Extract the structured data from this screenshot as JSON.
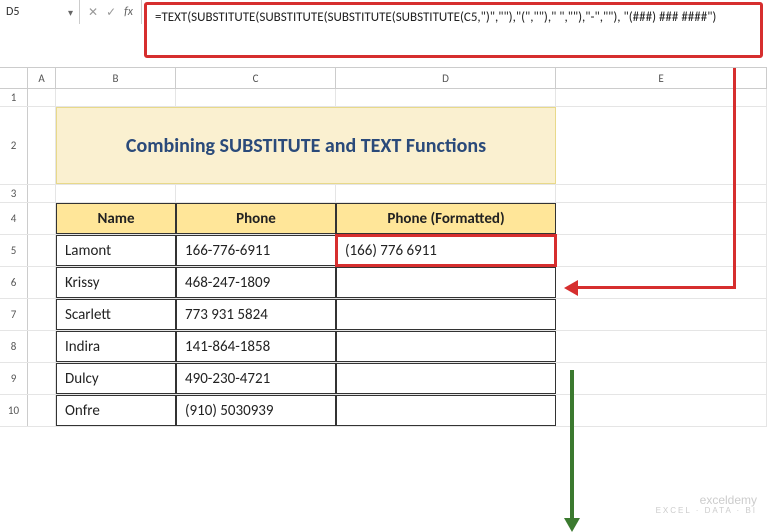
{
  "name_box": "D5",
  "formula": "=TEXT(SUBSTITUTE(SUBSTITUTE(SUBSTITUTE(SUBSTITUTE(C5,\")\",\"\"),\"(\",\"\"),\" \",\"\"),\"-\",\"\"), \"(###) ### ####\")",
  "cols": {
    "A": "A",
    "B": "B",
    "C": "C",
    "D": "D",
    "E": "E"
  },
  "rownums": {
    "1": "1",
    "2": "2",
    "3": "3",
    "4": "4",
    "5": "5",
    "6": "6",
    "7": "7",
    "8": "8",
    "9": "9",
    "10": "10"
  },
  "title": "Combining SUBSTITUTE and TEXT Functions",
  "headers": {
    "name": "Name",
    "phone": "Phone",
    "formatted": "Phone (Formatted)"
  },
  "rows": [
    {
      "name": "Lamont",
      "phone": "166-776-6911",
      "formatted": "(166) 776 6911"
    },
    {
      "name": "Krissy",
      "phone": "468-247-1809",
      "formatted": ""
    },
    {
      "name": "Scarlett",
      "phone": "773 931 5824",
      "formatted": ""
    },
    {
      "name": "Indira",
      "phone": "141-864-1858",
      "formatted": ""
    },
    {
      "name": "Dulcy",
      "phone": "490-230-4721",
      "formatted": ""
    },
    {
      "name": "Onfre",
      "phone": "(910) 5030939",
      "formatted": ""
    }
  ],
  "watermark": {
    "brand": "exceldemy",
    "sub": "EXCEL · DATA · BI"
  },
  "chart_data": {
    "type": "table",
    "title": "Combining SUBSTITUTE and TEXT Functions",
    "columns": [
      "Name",
      "Phone",
      "Phone (Formatted)"
    ],
    "rows": [
      [
        "Lamont",
        "166-776-6911",
        "(166) 776 6911"
      ],
      [
        "Krissy",
        "468-247-1809",
        ""
      ],
      [
        "Scarlett",
        "773 931 5824",
        ""
      ],
      [
        "Indira",
        "141-864-1858",
        ""
      ],
      [
        "Dulcy",
        "490-230-4721",
        ""
      ],
      [
        "Onfre",
        "(910) 5030939",
        ""
      ]
    ]
  }
}
